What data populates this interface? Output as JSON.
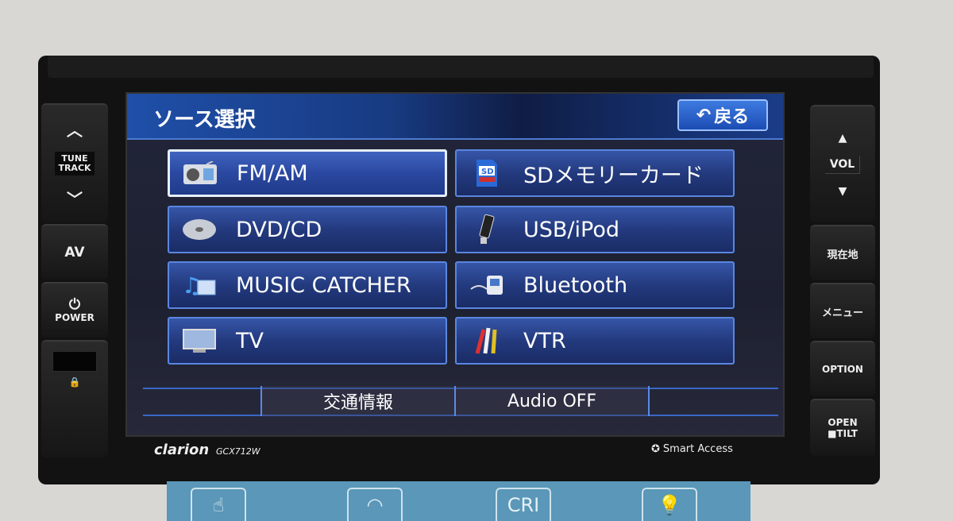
{
  "left_panel": {
    "tune_label": "TUNE\nTRACK",
    "tune_line1": "TUNE",
    "tune_line2": "TRACK",
    "av": "AV",
    "power": "POWER"
  },
  "right_panel": {
    "vol": "VOL",
    "current_location": "現在地",
    "menu": "メニュー",
    "option": "OPTION",
    "open": "OPEN",
    "tilt": "■TILT"
  },
  "screen": {
    "title": "ソース選択",
    "back_label": "戻る",
    "sources": [
      {
        "label": "FM/AM",
        "icon": "radio-icon",
        "selected": true
      },
      {
        "label": "SDメモリーカード",
        "icon": "sd-card-icon",
        "selected": false
      },
      {
        "label": "DVD/CD",
        "icon": "disc-icon",
        "selected": false
      },
      {
        "label": "USB/iPod",
        "icon": "usb-icon",
        "selected": false
      },
      {
        "label": "MUSIC CATCHER",
        "icon": "music-catcher-icon",
        "selected": false
      },
      {
        "label": "Bluetooth",
        "icon": "bluetooth-player-icon",
        "selected": false
      },
      {
        "label": "TV",
        "icon": "tv-icon",
        "selected": false
      },
      {
        "label": "VTR",
        "icon": "av-cable-icon",
        "selected": false
      }
    ],
    "bottom": {
      "traffic": "交通情報",
      "audio_off": "Audio OFF"
    }
  },
  "bezel": {
    "brand": "clarion",
    "model": "GCX712W",
    "smart_access": "Smart Access"
  },
  "box_label": "CRI",
  "colors": {
    "accent": "#2a4fb0",
    "header": "#1f4fa8",
    "border": "#5a86e0"
  }
}
